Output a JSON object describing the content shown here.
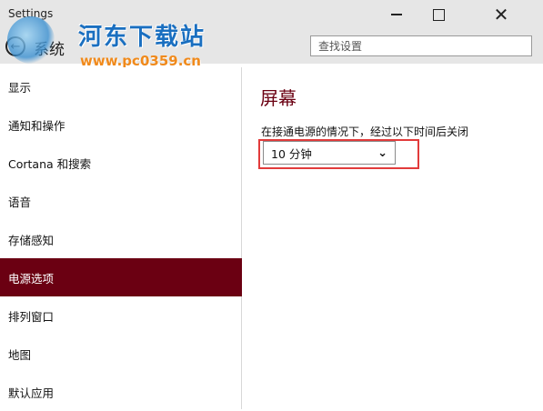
{
  "window": {
    "title": "Settings",
    "minimize_icon": "minimize-icon",
    "maximize_icon": "maximize-icon",
    "close_icon": "close-icon"
  },
  "header": {
    "back_icon": "back-arrow-icon",
    "title": "系统",
    "search_placeholder": "查找设置"
  },
  "watermark": {
    "name": "河东下载站",
    "url": "www.pc0359.cn"
  },
  "sidebar": {
    "items": [
      {
        "label": "显示"
      },
      {
        "label": "通知和操作"
      },
      {
        "label": "Cortana 和搜索"
      },
      {
        "label": "语音"
      },
      {
        "label": "存储感知"
      },
      {
        "label": "电源选项",
        "selected": true
      },
      {
        "label": "排列窗口"
      },
      {
        "label": "地图"
      },
      {
        "label": "默认应用"
      }
    ]
  },
  "content": {
    "section_title": "屏幕",
    "setting_label": "在接通电源的情况下，经过以下时间后关闭",
    "dropdown_value": "10 分钟"
  },
  "colors": {
    "accent": "#6b0012",
    "highlight": "#e23b3b"
  }
}
